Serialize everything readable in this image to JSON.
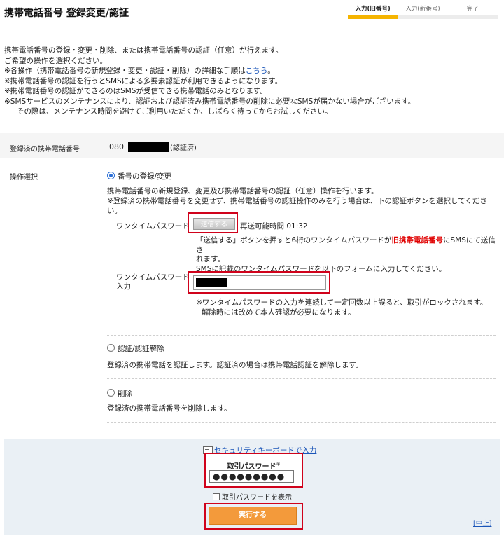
{
  "header": {
    "title": "携帯電話番号 登録変更/認証",
    "steps": [
      {
        "label": "入力(旧番号)",
        "active": true
      },
      {
        "label": "入力(新番号)",
        "active": false
      },
      {
        "label": "完了",
        "active": false
      }
    ]
  },
  "intro": {
    "line1": "携帯電話番号の登録・変更・削除、または携帯電話番号の認証（任意）が行えます。",
    "line2": "ご希望の操作を選択ください。",
    "note1_pre": "※各操作（携帯電話番号の新規登録・変更・認証・削除）の詳細な手順は",
    "note1_link": "こちら",
    "note1_post": "。",
    "note2": "※携帯電話番号の認証を行うとSMSによる多要素認証が利用できるようになります。",
    "note3": "※携帯電話番号の認証ができるのはSMSが受信できる携帯電話のみとなります。",
    "note4": "※SMSサービスのメンテナンスにより、認証および認証済み携帯電話番号の削除に必要なSMSが届かない場合がございます。",
    "note4b": "その際は、メンテナンス時間を避けてご利用いただくか、しばらく待ってからお試しください。"
  },
  "registered": {
    "label": "登録済の携帯電話番号",
    "prefix": "080",
    "status": "(認証済)"
  },
  "operation": {
    "label": "操作選択",
    "option1": {
      "label": "番号の登録/変更",
      "desc1": "携帯電話番号の新規登録、変更及び携帯電話番号の認証（任意）操作を行います。",
      "desc2": "※登録済の携帯電話番号を変更せず、携帯電話番号の認証操作のみを行う場合は、下の認証ボタンを選択してください。",
      "otp_label": "ワンタイムパスワード",
      "send_button": "送信する",
      "resend_text": "再送可能時間 01:32",
      "otp_desc_pre": "「送信する」ボタンを押すと6桁のワンタイムパスワードが",
      "otp_desc_red": "旧携帯電話番号",
      "otp_desc_post": "にSMSにて送信さ",
      "otp_desc_line2": "れます。",
      "otp_desc_line3": "SMSに記載のワンタイムパスワードを以下のフォームに入力してください。",
      "otp_input_label1": "ワンタイムパスワード",
      "otp_input_label2": "入力",
      "otp_warn1": "※ワンタイムパスワードの入力を連続して一定回数以上誤ると、取引がロックされます。",
      "otp_warn2": "解除時には改めて本人確認が必要になります。"
    },
    "option2": {
      "label": "認証/認証解除",
      "desc": "登録済の携帯電話を認証します。認証済の場合は携帯電話認証を解除します。"
    },
    "option3": {
      "label": "削除",
      "desc": "登録済の携帯電話番号を削除します。"
    }
  },
  "footer": {
    "keyboard_link": "セキュリティキーボードで入力",
    "password_label": "取引パスワード",
    "password_mark": "※",
    "password_value": "●●●●●●●●●",
    "show_password": "取引パスワードを表示",
    "execute_button": "実行する",
    "cancel_link": "[中止]"
  }
}
